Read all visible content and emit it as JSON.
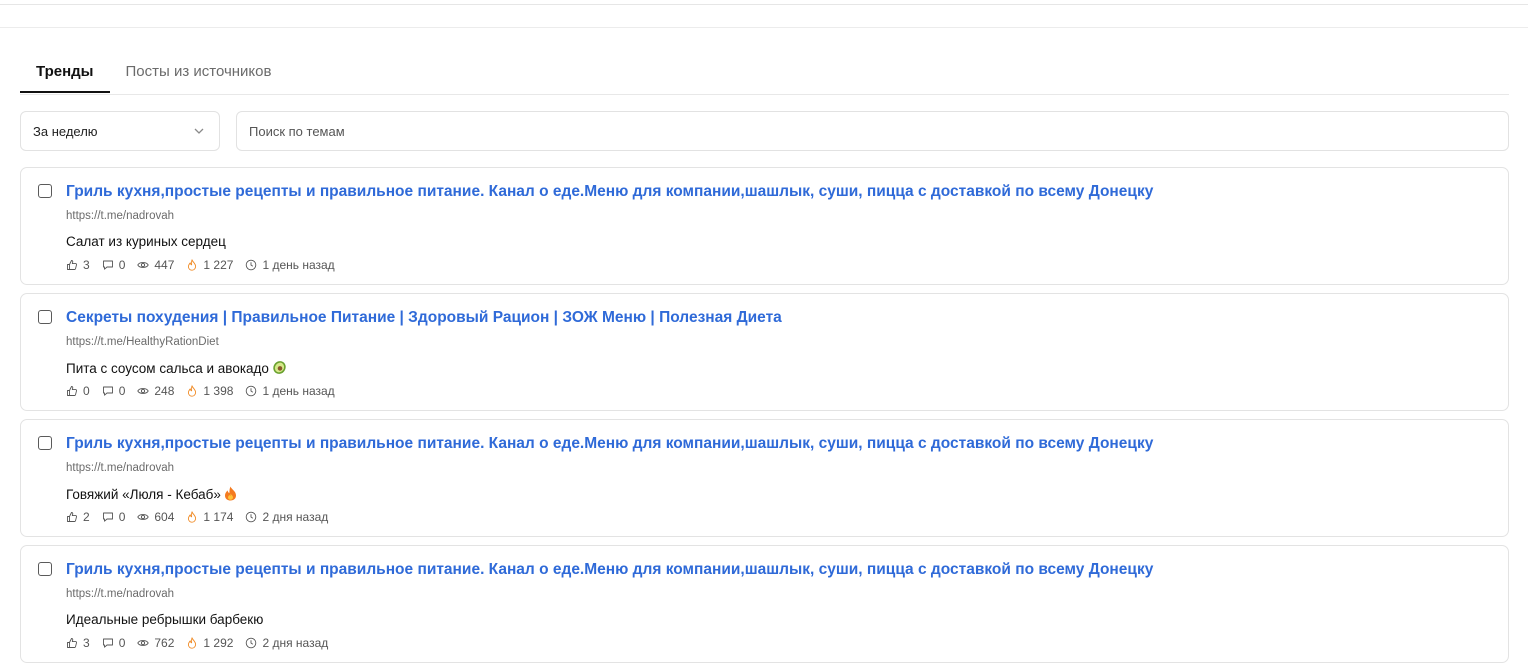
{
  "tabs": [
    {
      "label": "Тренды",
      "active": true
    },
    {
      "label": "Посты из источников",
      "active": false
    }
  ],
  "filters": {
    "period_value": "За неделю",
    "search_placeholder": "Поиск по темам"
  },
  "icons": {
    "like": "thumbs-up-icon",
    "comments": "comment-icon",
    "views": "eye-icon",
    "trend": "fire-icon",
    "time": "clock-icon"
  },
  "colors": {
    "title_link": "#2f6ad8",
    "fire": "#f08a24"
  },
  "posts": [
    {
      "title": "Гриль кухня,простые рецепты и правильное питание. Канал о еде.Меню для компании,шашлык, суши, пицца с доставкой по всему Донецку",
      "url": "https://t.me/nadrovah",
      "text": "Салат из куриных сердец",
      "emoji": "",
      "likes": "3",
      "comments": "0",
      "views": "447",
      "score": "1 227",
      "time": "1 день назад"
    },
    {
      "title": "Секреты похудения | Правильное Питание | Здоровый Рацион | ЗОЖ Меню | Полезная Диета",
      "url": "https://t.me/HealthyRationDiet",
      "text": "Пита с соусом сальса и авокадо",
      "emoji": "avocado",
      "likes": "0",
      "comments": "0",
      "views": "248",
      "score": "1 398",
      "time": "1 день назад"
    },
    {
      "title": "Гриль кухня,простые рецепты и правильное питание. Канал о еде.Меню для компании,шашлык, суши, пицца с доставкой по всему Донецку",
      "url": "https://t.me/nadrovah",
      "text": "Говяжий «Люля - Кебаб»",
      "emoji": "fire",
      "likes": "2",
      "comments": "0",
      "views": "604",
      "score": "1 174",
      "time": "2 дня назад"
    },
    {
      "title": "Гриль кухня,простые рецепты и правильное питание. Канал о еде.Меню для компании,шашлык, суши, пицца с доставкой по всему Донецку",
      "url": "https://t.me/nadrovah",
      "text": "Идеальные ребрышки барбекю",
      "emoji": "",
      "likes": "3",
      "comments": "0",
      "views": "762",
      "score": "1 292",
      "time": "2 дня назад"
    }
  ]
}
